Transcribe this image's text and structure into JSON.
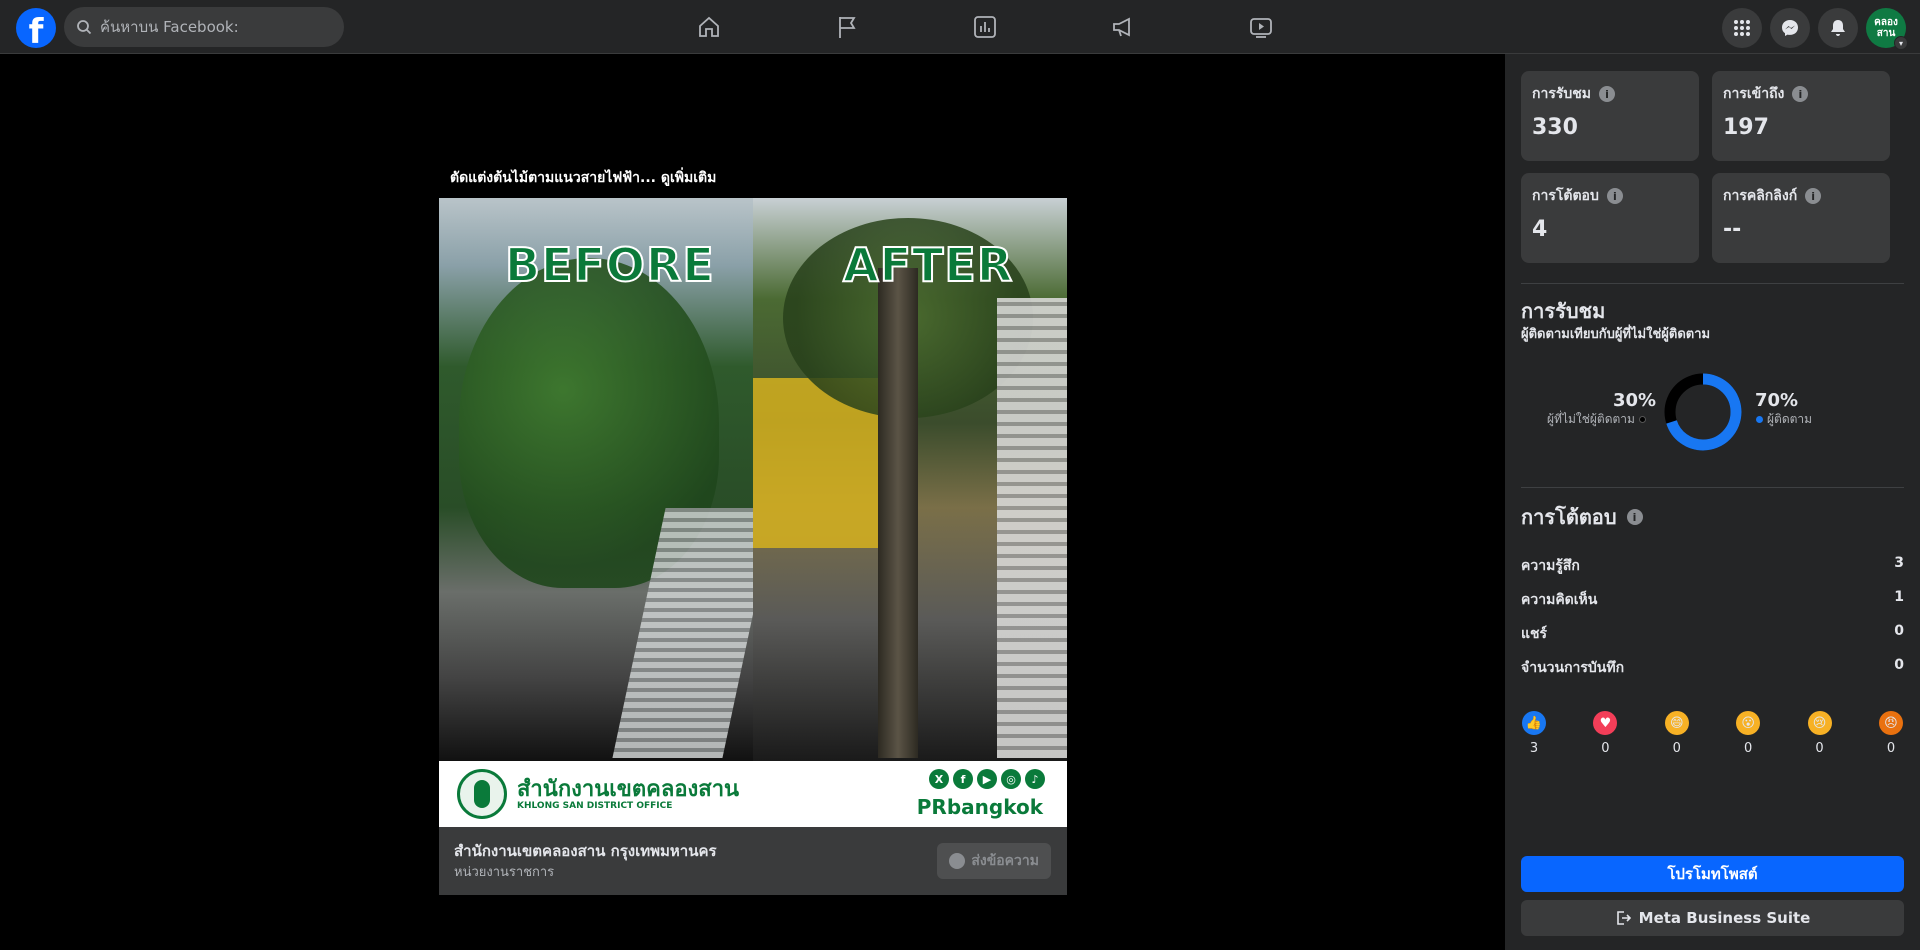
{
  "topbar": {
    "logo": "f",
    "search_placeholder": "ค้นหาบน Facebook:",
    "nav_icons": [
      "home-icon",
      "flag-icon",
      "chart-icon",
      "megaphone-icon",
      "video-icon"
    ],
    "right_icons": [
      "menu-grid-icon",
      "messenger-icon",
      "bell-icon"
    ],
    "avatar_text": "คลอง สาน"
  },
  "post": {
    "caption": "ตัดแต่งต้นไม้ตามแนวสายไฟฟ้า...",
    "see_more": "ดูเพิ่มเติม",
    "image": {
      "before_label": "BEFORE",
      "after_label": "AFTER",
      "org_th": "สำนักงานเขตคลองสาน",
      "org_en": "KHLONG SAN DISTRICT OFFICE",
      "brand": "PRbangkok",
      "socials": [
        "X",
        "f",
        "▶",
        "◎",
        "♪"
      ]
    },
    "page_name": "สำนักงานเขตคลองสาน กรุงเทพมหานคร",
    "page_type": "หน่วยงานราชการ",
    "message_button": "ส่งข้อความ"
  },
  "panel": {
    "stats": [
      {
        "label": "การรับชม",
        "value": "330"
      },
      {
        "label": "การเข้าถึง",
        "value": "197"
      },
      {
        "label": "การโต้ตอบ",
        "value": "4"
      },
      {
        "label": "การคลิกลิงก์",
        "value": "--"
      }
    ],
    "views_title": "การรับชม",
    "views_subtitle": "ผู้ติดตามเทียบกับผู้ที่ไม่ใช่ผู้ติดตาม",
    "non_followers_pct": "30%",
    "non_followers_label": "ผู้ที่ไม่ใช่ผู้ติดตาม",
    "followers_pct": "70%",
    "followers_label": "ผู้ติดตาม",
    "followers_fraction": 0.7,
    "colors": {
      "followers": "#1877f2",
      "non_followers": "#000000",
      "primary": "#0866ff"
    },
    "engagement_title": "การโต้ตอบ",
    "engagement_rows": [
      {
        "label": "ความรู้สึก",
        "value": "3"
      },
      {
        "label": "ความคิดเห็น",
        "value": "1"
      },
      {
        "label": "แชร์",
        "value": "0"
      },
      {
        "label": "จำนวนการบันทึก",
        "value": "0"
      }
    ],
    "reactions": [
      {
        "icon": "like-icon",
        "count": "3"
      },
      {
        "icon": "love-icon",
        "count": "0"
      },
      {
        "icon": "haha-icon",
        "count": "0"
      },
      {
        "icon": "wow-icon",
        "count": "0"
      },
      {
        "icon": "sad-icon",
        "count": "0"
      },
      {
        "icon": "angry-icon",
        "count": "0"
      }
    ],
    "promote_button": "โปรโมทโพสต์",
    "mbs_button": "Meta Business Suite"
  }
}
